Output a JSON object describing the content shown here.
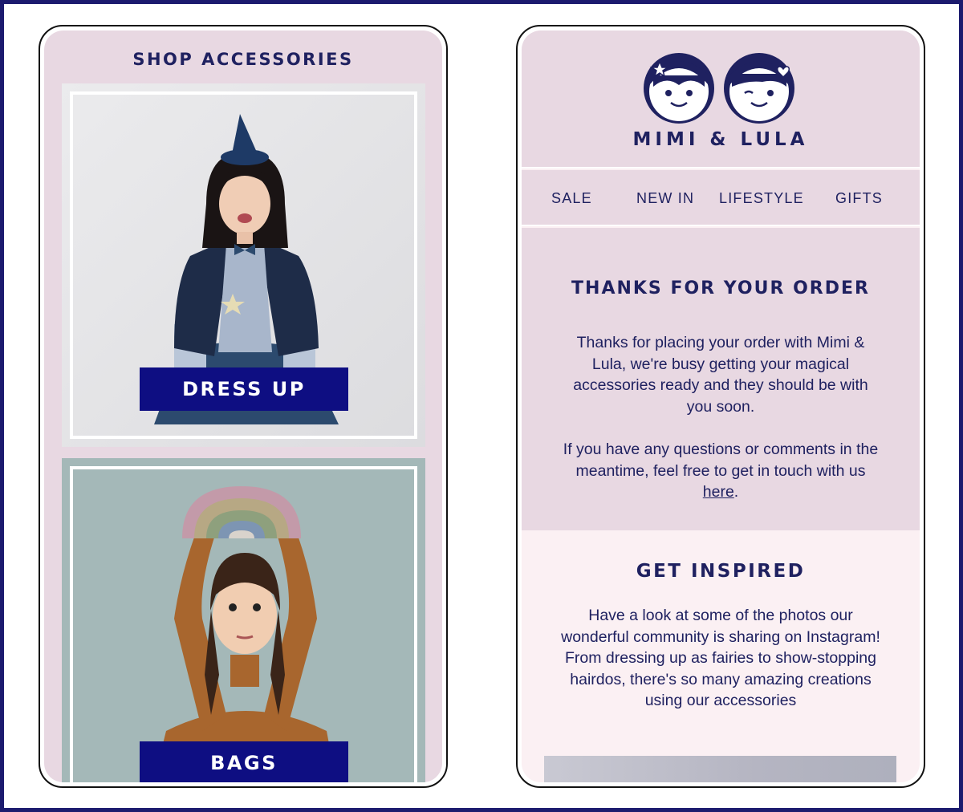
{
  "left_screen": {
    "section_title": "SHOP ACCESSORIES",
    "tiles": [
      {
        "label": "DRESS UP",
        "image": "girl-in-witch-costume-photo"
      },
      {
        "label": "BAGS",
        "image": "girl-holding-rainbow-bag-photo"
      }
    ]
  },
  "right_screen": {
    "brand": "MIMI & LULA",
    "logo": "two-cartoon-faces-logo",
    "nav": [
      "SALE",
      "NEW IN",
      "LIFESTYLE",
      "GIFTS"
    ],
    "order": {
      "title": "THANKS FOR YOUR ORDER",
      "paragraph1": "Thanks for placing your order with Mimi & Lula, we're busy getting your magical accessories ready and they should be with you soon.",
      "paragraph2_text": "If you have any questions or comments in the meantime, feel free to get in touch with us ",
      "paragraph2_link": "here",
      "paragraph2_end": "."
    },
    "inspire": {
      "title": "GET INSPIRED",
      "paragraph": "Have a look at some of the photos our wonderful community is sharing on Instagram! From dressing up as fairies to show-stopping hairdos, there's so many amazing creations using our accessories"
    }
  },
  "colors": {
    "navy": "#1f2160",
    "button_blue": "#0e0e82",
    "lilac": "#e8d8e2",
    "blush": "#fbf0f3",
    "frame": "#1c1b6e"
  }
}
